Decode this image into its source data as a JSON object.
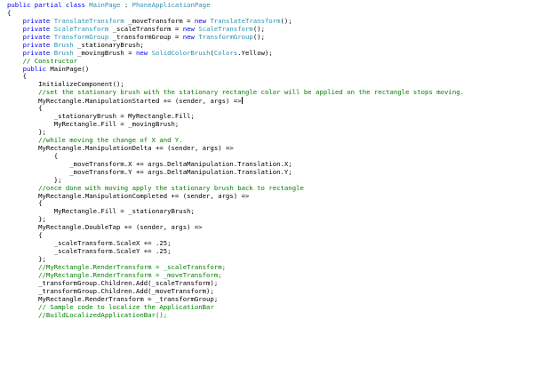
{
  "colors": {
    "background": "#ffffff",
    "keyword": "#0000ff",
    "type": "#2b91af",
    "comment": "#008000",
    "plain": "#000000"
  },
  "code_lines": [
    [
      {
        "t": "public partial class ",
        "c": "k"
      },
      {
        "t": "MainPage",
        "c": "t"
      },
      {
        "t": " : ",
        "c": "p"
      },
      {
        "t": "PhoneApplicationPage",
        "c": "t"
      }
    ],
    [
      {
        "t": "{",
        "c": "p"
      }
    ],
    [
      {
        "t": "    private ",
        "c": "k"
      },
      {
        "t": "TranslateTransform",
        "c": "t"
      },
      {
        "t": " _moveTransform = ",
        "c": "p"
      },
      {
        "t": "new ",
        "c": "k"
      },
      {
        "t": "TranslateTransform",
        "c": "t"
      },
      {
        "t": "();",
        "c": "p"
      }
    ],
    [
      {
        "t": "    private ",
        "c": "k"
      },
      {
        "t": "ScaleTransform",
        "c": "t"
      },
      {
        "t": " _scaleTransform = ",
        "c": "p"
      },
      {
        "t": "new ",
        "c": "k"
      },
      {
        "t": "ScaleTransform",
        "c": "t"
      },
      {
        "t": "();",
        "c": "p"
      }
    ],
    [
      {
        "t": "    private ",
        "c": "k"
      },
      {
        "t": "TransformGroup",
        "c": "t"
      },
      {
        "t": " _transformGroup = ",
        "c": "p"
      },
      {
        "t": "new ",
        "c": "k"
      },
      {
        "t": "TransformGroup",
        "c": "t"
      },
      {
        "t": "();",
        "c": "p"
      }
    ],
    [
      {
        "t": "    private ",
        "c": "k"
      },
      {
        "t": "Brush",
        "c": "t"
      },
      {
        "t": " _stationaryBrush;",
        "c": "p"
      }
    ],
    [
      {
        "t": "    private ",
        "c": "k"
      },
      {
        "t": "Brush",
        "c": "t"
      },
      {
        "t": " _movingBrush = ",
        "c": "p"
      },
      {
        "t": "new ",
        "c": "k"
      },
      {
        "t": "SolidColorBrush",
        "c": "t"
      },
      {
        "t": "(",
        "c": "p"
      },
      {
        "t": "Colors",
        "c": "t"
      },
      {
        "t": ".Yellow);",
        "c": "p"
      }
    ],
    [
      {
        "t": "    // Constructor",
        "c": "c"
      }
    ],
    [
      {
        "t": "    public ",
        "c": "k"
      },
      {
        "t": "MainPage()",
        "c": "p"
      }
    ],
    [
      {
        "t": "    {",
        "c": "p"
      }
    ],
    [
      {
        "t": "        InitializeComponent();",
        "c": "p"
      }
    ],
    [
      {
        "t": "        //set the stationary brush with the stationary rectangle color will be applied on the rectangle stops moving.",
        "c": "c"
      }
    ],
    [
      {
        "t": "        MyRectangle.ManipulationStarted += (sender, args) =>",
        "c": "p"
      },
      {
        "t": "",
        "c": "caret"
      }
    ],
    [
      {
        "t": "        {",
        "c": "p"
      }
    ],
    [
      {
        "t": "            _stationaryBrush = MyRectangle.Fill;",
        "c": "p"
      }
    ],
    [
      {
        "t": "            MyRectangle.Fill = _movingBrush;",
        "c": "p"
      }
    ],
    [
      {
        "t": "        };",
        "c": "p"
      }
    ],
    [
      {
        "t": "        //while moving the change of X and Y.",
        "c": "c"
      }
    ],
    [
      {
        "t": "        MyRectangle.ManipulationDelta += (sender, args) =>",
        "c": "p"
      }
    ],
    [
      {
        "t": "            {",
        "c": "p"
      }
    ],
    [
      {
        "t": "                _moveTransform.X += args.DeltaManipulation.Translation.X;",
        "c": "p"
      }
    ],
    [
      {
        "t": "                _moveTransform.Y += args.DeltaManipulation.Translation.Y;",
        "c": "p"
      }
    ],
    [
      {
        "t": "            };",
        "c": "p"
      }
    ],
    [
      {
        "t": "        //once done with moving apply the stationary brush back to rectangle",
        "c": "c"
      }
    ],
    [
      {
        "t": "        MyRectangle.ManipulationCompleted += (sender, args) =>",
        "c": "p"
      }
    ],
    [
      {
        "t": "        {",
        "c": "p"
      }
    ],
    [
      {
        "t": "            MyRectangle.Fill = _stationaryBrush;",
        "c": "p"
      }
    ],
    [
      {
        "t": "        };",
        "c": "p"
      }
    ],
    [
      {
        "t": "        MyRectangle.DoubleTap += (sender, args) =>",
        "c": "p"
      }
    ],
    [
      {
        "t": "        {",
        "c": "p"
      }
    ],
    [
      {
        "t": "            _scaleTransform.ScaleX += .25;",
        "c": "p"
      }
    ],
    [
      {
        "t": "            _scaleTransform.ScaleY += .25;",
        "c": "p"
      }
    ],
    [
      {
        "t": "        };",
        "c": "p"
      }
    ],
    [
      {
        "t": "        //MyRectangle.RenderTransform = _scaleTransform;",
        "c": "c"
      }
    ],
    [
      {
        "t": "        //MyRectangle.RenderTransform = _moveTransform;",
        "c": "c"
      }
    ],
    [
      {
        "t": "        _transformGroup.Children.Add(_scaleTransform);",
        "c": "p"
      }
    ],
    [
      {
        "t": "        _transformGroup.Children.Add(_moveTransform);",
        "c": "p"
      }
    ],
    [
      {
        "t": "        MyRectangle.RenderTransform = _transformGroup;",
        "c": "p"
      }
    ],
    [
      {
        "t": "        // Sample code to localize the ApplicationBar",
        "c": "c"
      }
    ],
    [
      {
        "t": "        //BuildLocalizedApplicationBar();",
        "c": "c"
      }
    ]
  ]
}
